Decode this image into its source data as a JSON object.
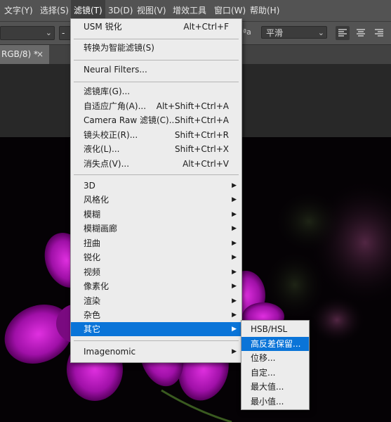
{
  "menubar": {
    "items": [
      "文字(Y)",
      "选择(S)",
      "滤镜(T)",
      "3D(D)",
      "视图(V)",
      "增效工具",
      "窗口(W)",
      "帮助(H)"
    ]
  },
  "options": {
    "font_style": "平滑",
    "left_field": "-"
  },
  "tab": {
    "title": "RGB/8) *",
    "close": "×"
  },
  "filter_menu": {
    "items": [
      {
        "label": "USM 锐化",
        "shortcut": "Alt+Ctrl+F"
      },
      {
        "label": "转换为智能滤镜(S)",
        "shortcut": ""
      },
      {
        "label": "Neural Filters...",
        "shortcut": ""
      },
      {
        "label": "滤镜库(G)...",
        "shortcut": ""
      },
      {
        "label": "自适应广角(A)...",
        "shortcut": "Alt+Shift+Ctrl+A"
      },
      {
        "label": "Camera Raw 滤镜(C)...",
        "shortcut": "Shift+Ctrl+A"
      },
      {
        "label": "镜头校正(R)...",
        "shortcut": "Shift+Ctrl+R"
      },
      {
        "label": "液化(L)...",
        "shortcut": "Shift+Ctrl+X"
      },
      {
        "label": "消失点(V)...",
        "shortcut": "Alt+Ctrl+V"
      },
      {
        "label": "3D",
        "shortcut": ""
      },
      {
        "label": "风格化",
        "shortcut": ""
      },
      {
        "label": "模糊",
        "shortcut": ""
      },
      {
        "label": "模糊画廊",
        "shortcut": ""
      },
      {
        "label": "扭曲",
        "shortcut": ""
      },
      {
        "label": "锐化",
        "shortcut": ""
      },
      {
        "label": "视频",
        "shortcut": ""
      },
      {
        "label": "像素化",
        "shortcut": ""
      },
      {
        "label": "渲染",
        "shortcut": ""
      },
      {
        "label": "杂色",
        "shortcut": ""
      },
      {
        "label": "其它",
        "shortcut": ""
      },
      {
        "label": "Imagenomic",
        "shortcut": ""
      }
    ]
  },
  "other_submenu": {
    "items": [
      "HSB/HSL",
      "高反差保留...",
      "位移...",
      "自定...",
      "最大值...",
      "最小值..."
    ]
  },
  "colors": {
    "highlight": "#0a74d8",
    "menu_bg": "#ececec",
    "ui_bg": "#535353",
    "flower": "#c020c8"
  }
}
